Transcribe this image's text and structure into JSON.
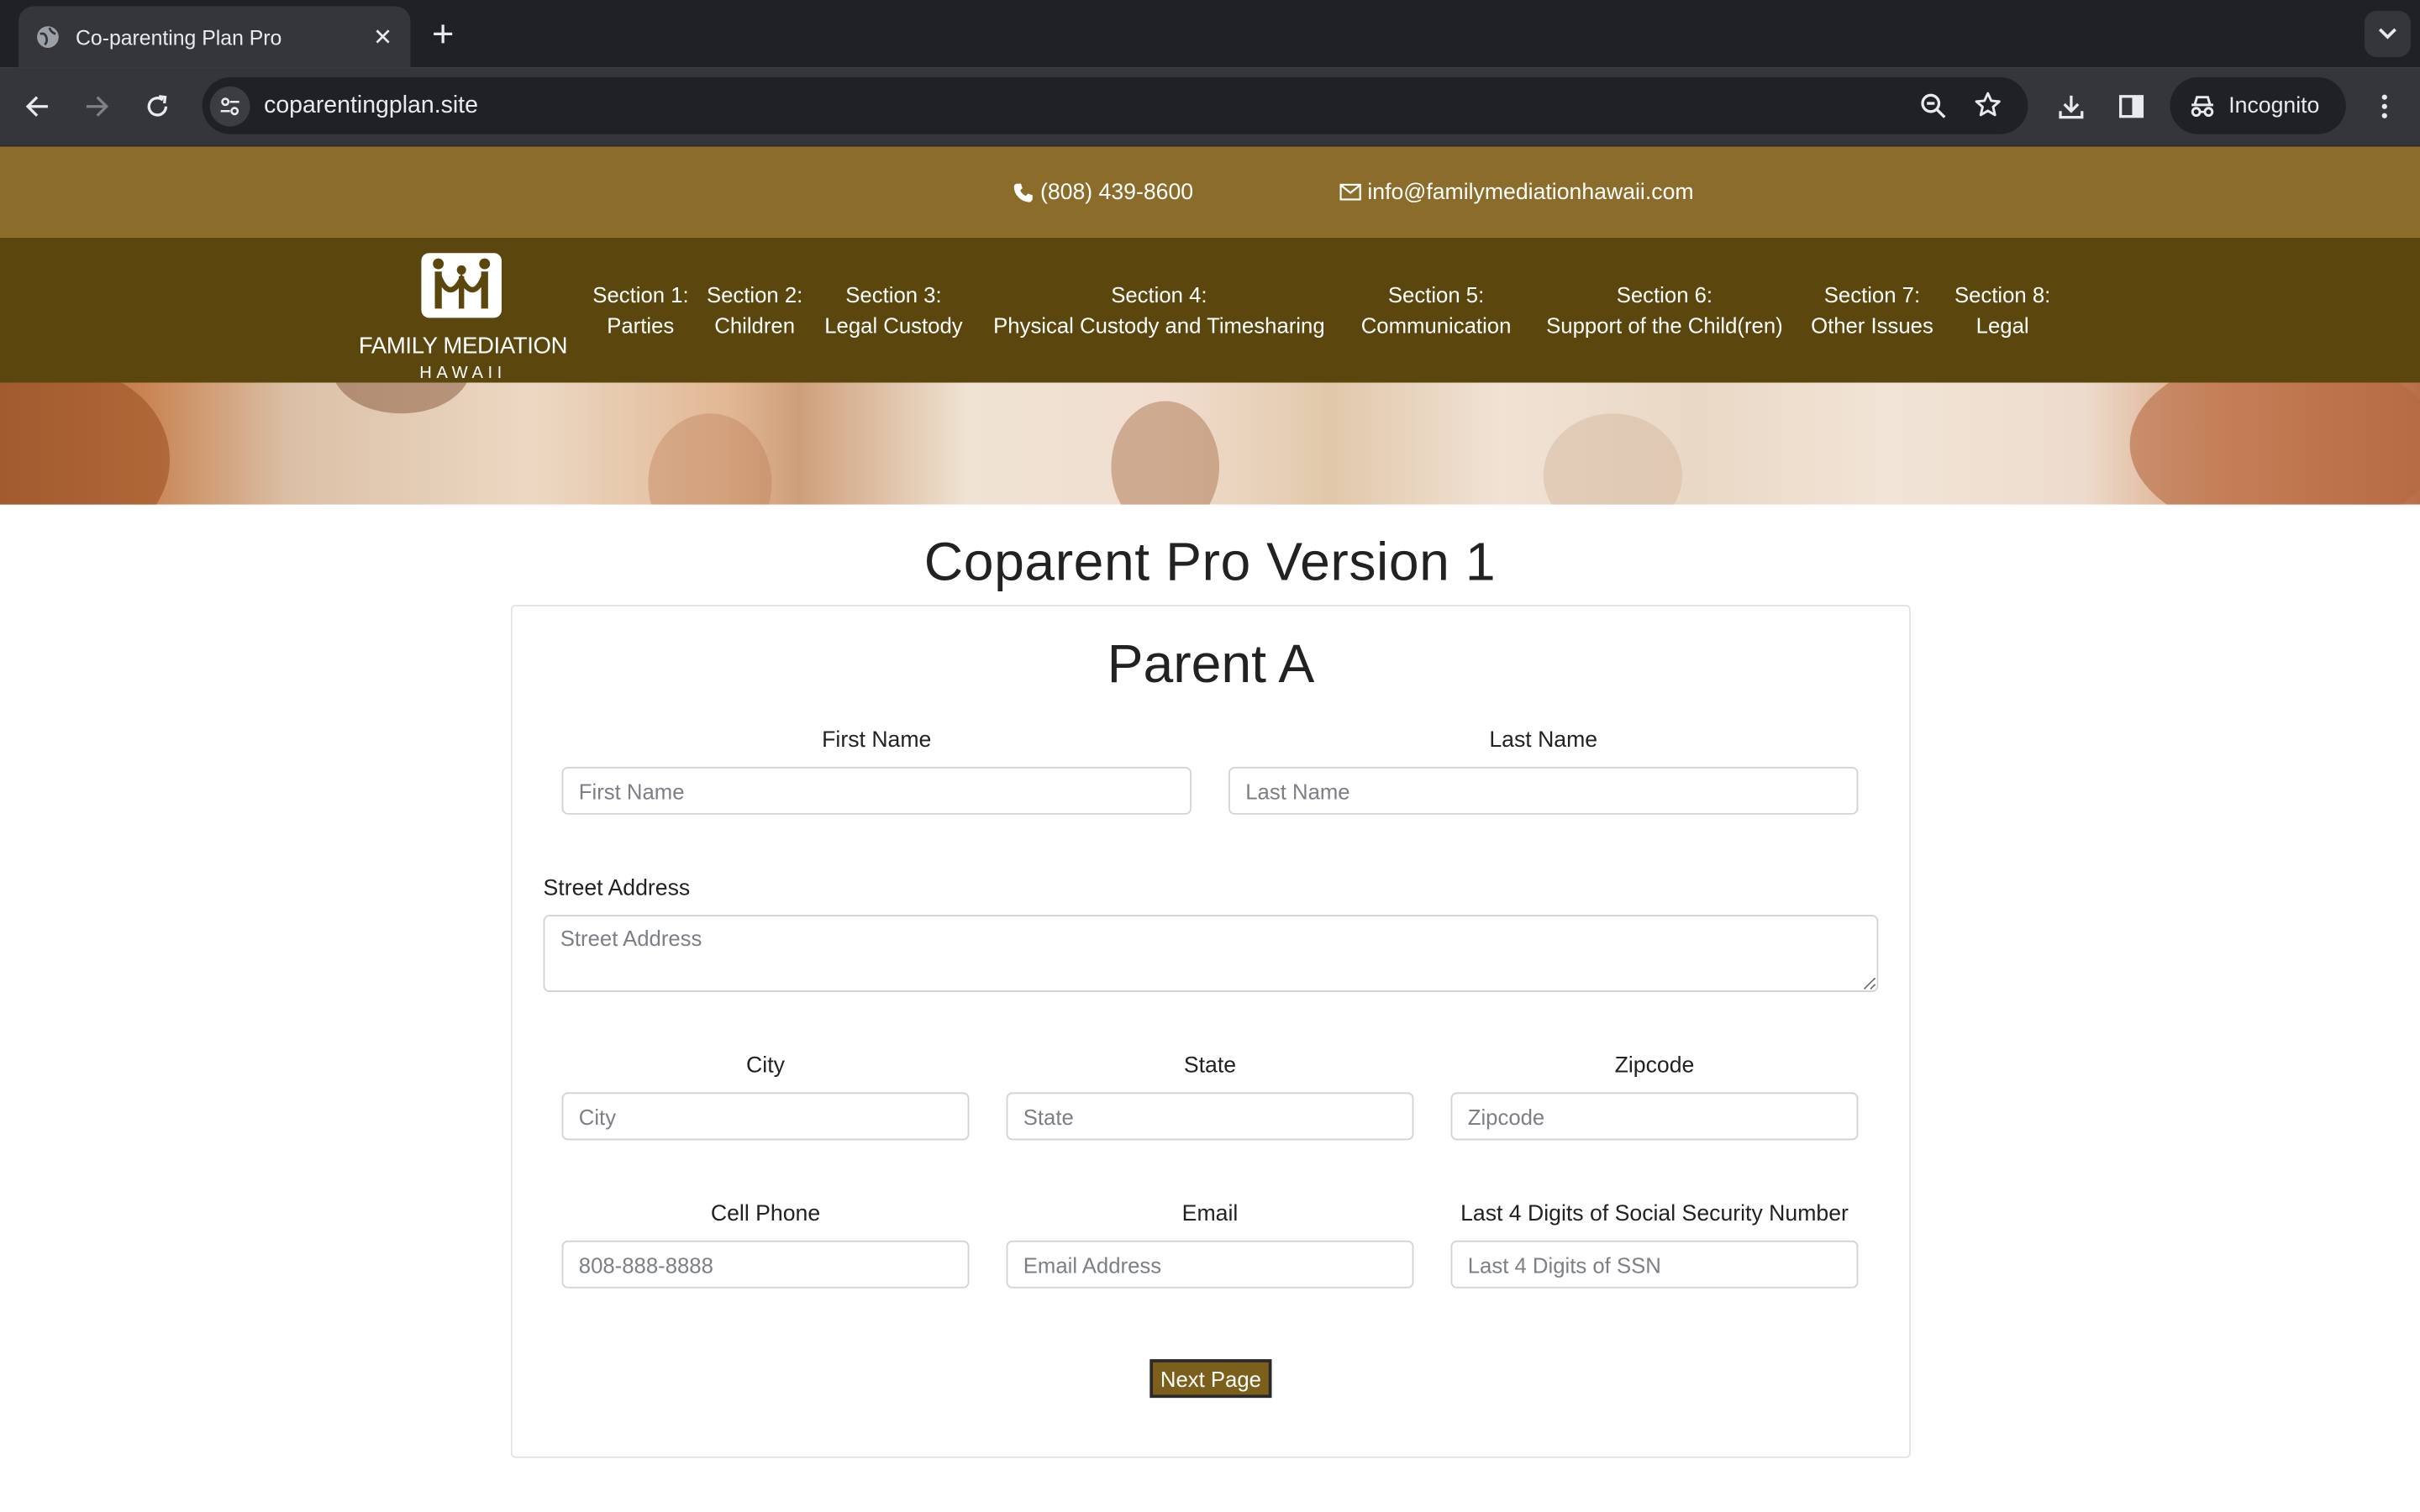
{
  "browser": {
    "tab_title": "Co-parenting Plan Pro",
    "url": "coparentingplan.site",
    "profile_label": "Incognito"
  },
  "site": {
    "phone": "(808) 439-8600",
    "email": "info@familymediationhawaii.com",
    "logo_name": "FAMILY MEDIATION",
    "logo_sub": "HAWAII",
    "nav": [
      {
        "top": "Section 1:",
        "bottom": "Parties"
      },
      {
        "top": "Section 2:",
        "bottom": "Children"
      },
      {
        "top": "Section 3:",
        "bottom": "Legal Custody"
      },
      {
        "top": "Section 4:",
        "bottom": "Physical Custody and Timesharing"
      },
      {
        "top": "Section 5:",
        "bottom": "Communication"
      },
      {
        "top": "Section 6:",
        "bottom": "Support of the Child(ren)"
      },
      {
        "top": "Section 7:",
        "bottom": "Other Issues"
      },
      {
        "top": "Section 8:",
        "bottom": "Legal"
      }
    ],
    "colors": {
      "topbar": "#8b6c2a",
      "navbar": "#5b470d",
      "button": "#7c5f1b"
    }
  },
  "page": {
    "title": "Coparent Pro Version 1",
    "form_title": "Parent A",
    "fields": {
      "first_name": {
        "label": "First Name",
        "placeholder": "First Name",
        "value": ""
      },
      "last_name": {
        "label": "Last Name",
        "placeholder": "Last Name",
        "value": ""
      },
      "street": {
        "label": "Street Address",
        "placeholder": "Street Address",
        "value": ""
      },
      "city": {
        "label": "City",
        "placeholder": "City",
        "value": ""
      },
      "state": {
        "label": "State",
        "placeholder": "State",
        "value": ""
      },
      "zipcode": {
        "label": "Zipcode",
        "placeholder": "Zipcode",
        "value": ""
      },
      "cell": {
        "label": "Cell Phone",
        "placeholder": "808-888-8888",
        "value": ""
      },
      "email": {
        "label": "Email",
        "placeholder": "Email Address",
        "value": ""
      },
      "ssn4": {
        "label": "Last 4 Digits of Social Security Number",
        "placeholder": "Last 4 Digits of SSN",
        "value": ""
      }
    },
    "next_button": "Next Page"
  }
}
